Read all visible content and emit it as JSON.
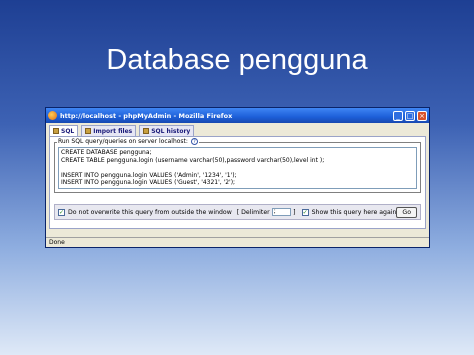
{
  "slide": {
    "title": "Database pengguna"
  },
  "window": {
    "title": "http://localhost - phpMyAdmin - Mozilla Firefox",
    "buttons": {
      "minimize": "_",
      "maximize": "□",
      "close": "×"
    }
  },
  "tabs": [
    {
      "label": "SQL"
    },
    {
      "label": "Import files"
    },
    {
      "label": "SQL history"
    }
  ],
  "query_box": {
    "legend": "Run SQL query/queries on server localhost:",
    "help_glyph": "?",
    "sql": "CREATE DATABASE pengguna;\nCREATE TABLE pengguna.login (username varchar(50),password varchar(50),level int );\n\nINSERT INTO pengguna.login VALUES ('Admin', '1234', '1');\nINSERT INTO pengguna.login VALUES ('Guest', '4321', '2');"
  },
  "options": {
    "overwrite_label": "Do not overwrite this query from outside the window",
    "delimiter_label": "[ Delimiter",
    "delimiter_value": ";",
    "delimiter_close": "]",
    "show_query_label": "Show this query here again",
    "go_label": "Go",
    "overwrite_checked": true,
    "show_query_checked": true
  },
  "status_bar": {
    "text": "Done"
  }
}
